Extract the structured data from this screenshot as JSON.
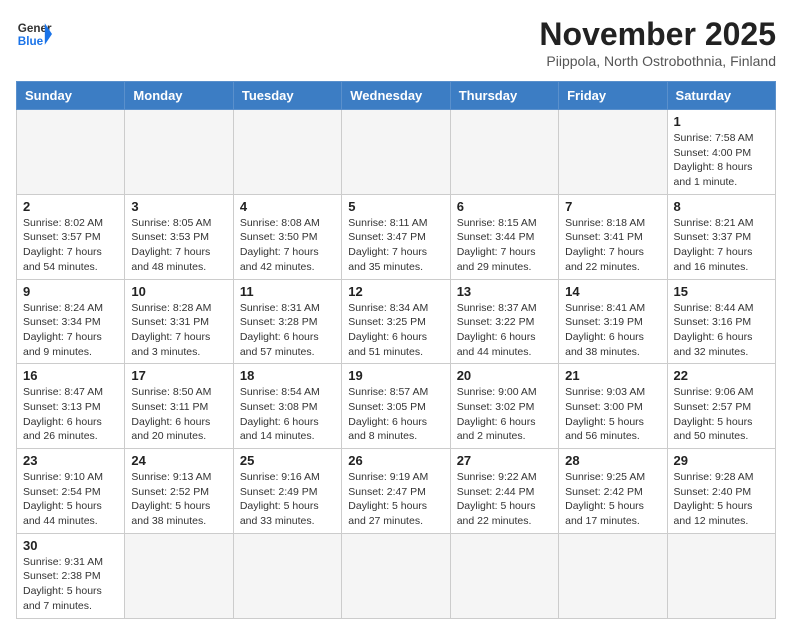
{
  "header": {
    "logo_general": "General",
    "logo_blue": "Blue",
    "month_title": "November 2025",
    "location": "Piippola, North Ostrobothnia, Finland"
  },
  "columns": [
    "Sunday",
    "Monday",
    "Tuesday",
    "Wednesday",
    "Thursday",
    "Friday",
    "Saturday"
  ],
  "days": {
    "d1": {
      "num": "1",
      "info": "Sunrise: 7:58 AM\nSunset: 4:00 PM\nDaylight: 8 hours\nand 1 minute."
    },
    "d2": {
      "num": "2",
      "info": "Sunrise: 8:02 AM\nSunset: 3:57 PM\nDaylight: 7 hours\nand 54 minutes."
    },
    "d3": {
      "num": "3",
      "info": "Sunrise: 8:05 AM\nSunset: 3:53 PM\nDaylight: 7 hours\nand 48 minutes."
    },
    "d4": {
      "num": "4",
      "info": "Sunrise: 8:08 AM\nSunset: 3:50 PM\nDaylight: 7 hours\nand 42 minutes."
    },
    "d5": {
      "num": "5",
      "info": "Sunrise: 8:11 AM\nSunset: 3:47 PM\nDaylight: 7 hours\nand 35 minutes."
    },
    "d6": {
      "num": "6",
      "info": "Sunrise: 8:15 AM\nSunset: 3:44 PM\nDaylight: 7 hours\nand 29 minutes."
    },
    "d7": {
      "num": "7",
      "info": "Sunrise: 8:18 AM\nSunset: 3:41 PM\nDaylight: 7 hours\nand 22 minutes."
    },
    "d8": {
      "num": "8",
      "info": "Sunrise: 8:21 AM\nSunset: 3:37 PM\nDaylight: 7 hours\nand 16 minutes."
    },
    "d9": {
      "num": "9",
      "info": "Sunrise: 8:24 AM\nSunset: 3:34 PM\nDaylight: 7 hours\nand 9 minutes."
    },
    "d10": {
      "num": "10",
      "info": "Sunrise: 8:28 AM\nSunset: 3:31 PM\nDaylight: 7 hours\nand 3 minutes."
    },
    "d11": {
      "num": "11",
      "info": "Sunrise: 8:31 AM\nSunset: 3:28 PM\nDaylight: 6 hours\nand 57 minutes."
    },
    "d12": {
      "num": "12",
      "info": "Sunrise: 8:34 AM\nSunset: 3:25 PM\nDaylight: 6 hours\nand 51 minutes."
    },
    "d13": {
      "num": "13",
      "info": "Sunrise: 8:37 AM\nSunset: 3:22 PM\nDaylight: 6 hours\nand 44 minutes."
    },
    "d14": {
      "num": "14",
      "info": "Sunrise: 8:41 AM\nSunset: 3:19 PM\nDaylight: 6 hours\nand 38 minutes."
    },
    "d15": {
      "num": "15",
      "info": "Sunrise: 8:44 AM\nSunset: 3:16 PM\nDaylight: 6 hours\nand 32 minutes."
    },
    "d16": {
      "num": "16",
      "info": "Sunrise: 8:47 AM\nSunset: 3:13 PM\nDaylight: 6 hours\nand 26 minutes."
    },
    "d17": {
      "num": "17",
      "info": "Sunrise: 8:50 AM\nSunset: 3:11 PM\nDaylight: 6 hours\nand 20 minutes."
    },
    "d18": {
      "num": "18",
      "info": "Sunrise: 8:54 AM\nSunset: 3:08 PM\nDaylight: 6 hours\nand 14 minutes."
    },
    "d19": {
      "num": "19",
      "info": "Sunrise: 8:57 AM\nSunset: 3:05 PM\nDaylight: 6 hours\nand 8 minutes."
    },
    "d20": {
      "num": "20",
      "info": "Sunrise: 9:00 AM\nSunset: 3:02 PM\nDaylight: 6 hours\nand 2 minutes."
    },
    "d21": {
      "num": "21",
      "info": "Sunrise: 9:03 AM\nSunset: 3:00 PM\nDaylight: 5 hours\nand 56 minutes."
    },
    "d22": {
      "num": "22",
      "info": "Sunrise: 9:06 AM\nSunset: 2:57 PM\nDaylight: 5 hours\nand 50 minutes."
    },
    "d23": {
      "num": "23",
      "info": "Sunrise: 9:10 AM\nSunset: 2:54 PM\nDaylight: 5 hours\nand 44 minutes."
    },
    "d24": {
      "num": "24",
      "info": "Sunrise: 9:13 AM\nSunset: 2:52 PM\nDaylight: 5 hours\nand 38 minutes."
    },
    "d25": {
      "num": "25",
      "info": "Sunrise: 9:16 AM\nSunset: 2:49 PM\nDaylight: 5 hours\nand 33 minutes."
    },
    "d26": {
      "num": "26",
      "info": "Sunrise: 9:19 AM\nSunset: 2:47 PM\nDaylight: 5 hours\nand 27 minutes."
    },
    "d27": {
      "num": "27",
      "info": "Sunrise: 9:22 AM\nSunset: 2:44 PM\nDaylight: 5 hours\nand 22 minutes."
    },
    "d28": {
      "num": "28",
      "info": "Sunrise: 9:25 AM\nSunset: 2:42 PM\nDaylight: 5 hours\nand 17 minutes."
    },
    "d29": {
      "num": "29",
      "info": "Sunrise: 9:28 AM\nSunset: 2:40 PM\nDaylight: 5 hours\nand 12 minutes."
    },
    "d30": {
      "num": "30",
      "info": "Sunrise: 9:31 AM\nSunset: 2:38 PM\nDaylight: 5 hours\nand 7 minutes."
    }
  }
}
